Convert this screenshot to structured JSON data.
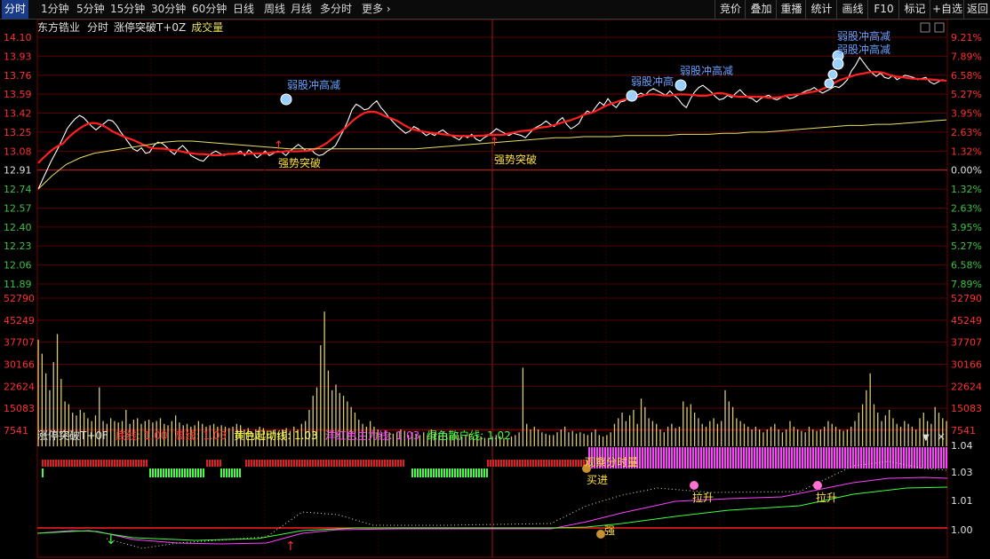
{
  "toolbar": {
    "periods": [
      "分时",
      "1分钟",
      "5分钟",
      "15分钟",
      "30分钟",
      "60分钟",
      "日线",
      "周线",
      "月线",
      "多分时",
      "更多"
    ],
    "right_buttons": [
      "竞价",
      "叠加",
      "重播",
      "统计",
      "画线",
      "F10",
      "标记",
      "+自选",
      "返回"
    ]
  },
  "header": {
    "stock": "东方锆业",
    "mode": "分时",
    "indicator": "涨停突破T+0Z",
    "volume_label": "成交量"
  },
  "price_axis": {
    "left": [
      "14.10",
      "13.93",
      "13.76",
      "13.59",
      "13.42",
      "13.25",
      "13.08",
      "12.91",
      "12.74",
      "12.57",
      "12.40",
      "12.23",
      "12.06",
      "11.89"
    ],
    "right": [
      "9.21%",
      "7.89%",
      "6.58%",
      "5.27%",
      "3.95%",
      "2.63%",
      "1.32%",
      "0.00%",
      "1.32%",
      "2.63%",
      "3.95%",
      "5.27%",
      "6.58%",
      "7.89%"
    ]
  },
  "volume_axis": [
    "52790",
    "45249",
    "37707",
    "30166",
    "22624",
    "15083",
    "7541"
  ],
  "indicator_panel": {
    "name": "涨停突破T+0F",
    "lines": [
      {
        "label": "底线:",
        "value": "1.00",
        "color": "#ff3030"
      },
      {
        "label": "高线:",
        "value": "1.03",
        "color": "#ff3030"
      },
      {
        "label": "黄色起动线:",
        "value": "1.03",
        "color": "#ffff40"
      },
      {
        "label": "洋红色主力线:",
        "value": "1.03",
        "color": "#ff40ff"
      },
      {
        "label": "绿色散户线:",
        "value": "1.02",
        "color": "#40ff40"
      }
    ],
    "axis": [
      "1.04",
      "1.03",
      "1.01",
      "1.00"
    ]
  },
  "annotations": {
    "weak": [
      "弱股冲高减",
      "弱股冲高",
      "弱股冲高减",
      "弱股冲高减",
      "弱股冲高减"
    ],
    "strong": [
      "强势突破",
      "强势突破"
    ],
    "observe": "观察分时量",
    "buy": "买进",
    "strong_lower": "强",
    "rise": [
      "拉升",
      "拉升"
    ]
  },
  "colors": {
    "up": "#ff3030",
    "price": "#ffffff",
    "avg": "#e8e060",
    "volume": "#d8c878",
    "grid": "#7a0000",
    "magenta": "#ff40ff",
    "green": "#40ff40"
  },
  "chart_data": {
    "type": "line",
    "prev_close": 12.91,
    "ylim": [
      11.89,
      14.1
    ],
    "vol_max": 52790,
    "price": [
      12.74,
      12.82,
      12.9,
      12.98,
      13.05,
      13.12,
      13.2,
      13.28,
      13.33,
      13.37,
      13.4,
      13.38,
      13.34,
      13.3,
      13.27,
      13.3,
      13.33,
      13.36,
      13.35,
      13.31,
      13.25,
      13.2,
      13.15,
      13.1,
      13.08,
      13.11,
      13.06,
      13.07,
      13.13,
      13.16,
      13.15,
      13.12,
      13.08,
      13.05,
      13.1,
      13.13,
      13.09,
      13.04,
      13.02,
      13.0,
      12.99,
      13.03,
      13.06,
      13.08,
      13.06,
      13.04,
      13.06,
      13.05,
      13.06,
      13.08,
      13.04,
      13.09,
      13.06,
      13.02,
      13.05,
      13.08,
      13.04,
      13.06,
      13.08,
      13.07,
      13.04,
      13.08,
      13.11,
      13.14,
      13.11,
      13.08,
      13.1,
      13.06,
      13.04,
      13.05,
      13.08,
      13.1,
      13.13,
      13.2,
      13.27,
      13.35,
      13.45,
      13.5,
      13.48,
      13.45,
      13.46,
      13.5,
      13.53,
      13.47,
      13.43,
      13.38,
      13.34,
      13.3,
      13.27,
      13.24,
      13.26,
      13.3,
      13.28,
      13.25,
      13.22,
      13.24,
      13.22,
      13.25,
      13.27,
      13.24,
      13.22,
      13.2,
      13.18,
      13.22,
      13.2,
      13.23,
      13.19,
      13.17,
      13.2,
      13.22,
      13.25,
      13.28,
      13.26,
      13.24,
      13.22,
      13.24,
      13.23,
      13.22,
      13.2,
      13.24,
      13.28,
      13.3,
      13.32,
      13.35,
      13.32,
      13.3,
      13.35,
      13.38,
      13.32,
      13.28,
      13.3,
      13.33,
      13.4,
      13.44,
      13.42,
      13.47,
      13.52,
      13.49,
      13.55,
      13.5,
      13.47,
      13.52,
      13.53,
      13.56,
      13.54,
      13.58,
      13.6,
      13.58,
      13.62,
      13.64,
      13.62,
      13.6,
      13.58,
      13.62,
      13.58,
      13.55,
      13.5,
      13.47,
      13.55,
      13.61,
      13.65,
      13.67,
      13.64,
      13.61,
      13.57,
      13.54,
      13.55,
      13.58,
      13.56,
      13.6,
      13.63,
      13.59,
      13.56,
      13.55,
      13.52,
      13.55,
      13.57,
      13.58,
      13.55,
      13.54,
      13.56,
      13.58,
      13.55,
      13.56,
      13.58,
      13.6,
      13.62,
      13.63,
      13.65,
      13.62,
      13.6,
      13.62,
      13.64,
      13.66,
      13.65,
      13.68,
      13.72,
      13.8,
      13.85,
      13.92,
      13.87,
      13.82,
      13.78,
      13.75,
      13.78,
      13.74,
      13.73,
      13.76,
      13.72,
      13.74,
      13.76,
      13.75,
      13.74,
      13.72,
      13.73,
      13.74,
      13.7,
      13.68,
      13.7,
      13.72,
      13.71
    ],
    "avg": [
      12.74,
      12.86,
      12.96,
      13.02,
      13.06,
      13.08,
      13.1,
      13.12,
      13.14,
      13.16,
      13.17,
      13.17,
      13.16,
      13.15,
      13.14,
      13.13,
      13.12,
      13.11,
      13.1,
      13.1,
      13.1,
      13.1,
      13.1,
      13.1,
      13.1,
      13.1,
      13.1,
      13.1,
      13.11,
      13.12,
      13.13,
      13.14,
      13.15,
      13.16,
      13.17,
      13.18,
      13.19,
      13.2,
      13.2,
      13.21,
      13.21,
      13.21,
      13.22,
      13.22,
      13.22,
      13.22,
      13.23,
      13.23,
      13.23,
      13.24,
      13.24,
      13.25,
      13.25,
      13.26,
      13.27,
      13.28,
      13.29,
      13.3,
      13.31,
      13.31,
      13.32,
      13.32,
      13.33,
      13.34,
      13.35,
      13.36
    ],
    "volume": [
      38000,
      33000,
      26000,
      20000,
      30000,
      40000,
      24000,
      16000,
      15000,
      12000,
      11000,
      13000,
      12000,
      10000,
      9000,
      11000,
      21000,
      9000,
      8000,
      10000,
      9000,
      8500,
      9000,
      13000,
      8000,
      9500,
      10000,
      8000,
      9000,
      9500,
      8500,
      9000,
      10000,
      8000,
      7500,
      9000,
      11000,
      8500,
      7500,
      8000,
      7000,
      7500,
      9000,
      8000,
      7000,
      7500,
      8000,
      7000,
      7500,
      7000,
      6500,
      7000,
      8000,
      7500,
      6000,
      6500,
      5000,
      6000,
      7000,
      6500,
      5500,
      5500,
      6000,
      5000,
      6000,
      6500,
      5500,
      7000,
      6000,
      8000,
      9000,
      13000,
      18000,
      21000,
      36000,
      48000,
      27000,
      20000,
      22000,
      19000,
      18000,
      16000,
      14000,
      12000,
      9500,
      8000,
      7000,
      9000,
      7000,
      6000,
      5000,
      5500,
      5000,
      4500,
      5000,
      6000,
      5500,
      4000,
      5000,
      4500,
      4000,
      5000,
      4000,
      6000,
      5000,
      4000,
      5000,
      4500,
      4000,
      4500,
      4000,
      3500,
      4000,
      4500,
      3500,
      4000,
      3500,
      3000,
      3000,
      3500,
      4000,
      3500,
      3000,
      2500,
      3500,
      4000,
      5000,
      28000,
      8000,
      6000,
      7000,
      6000,
      5000,
      4500,
      4000,
      4000,
      5000,
      6000,
      7000,
      5000,
      5500,
      4500,
      5000,
      4500,
      4000,
      5000,
      6000,
      4000,
      3500,
      4000,
      5000,
      8000,
      10000,
      12000,
      9000,
      11000,
      13000,
      8000,
      17000,
      14000,
      10000,
      9000,
      8000,
      6000,
      5000,
      7000,
      8000,
      6500,
      7000,
      16000,
      14000,
      15000,
      12000,
      10000,
      8000,
      7000,
      9000,
      10000,
      8000,
      9000,
      20000,
      16000,
      14000,
      10000,
      9000,
      8000,
      7000,
      6000,
      7000,
      6000,
      5000,
      6000,
      7000,
      8000,
      6000,
      5000,
      6000,
      9000,
      7000,
      6000,
      5500,
      5000,
      7000,
      6000,
      5500,
      6000,
      7000,
      9000,
      8000,
      7000,
      6000,
      5500,
      6000,
      7000,
      9000,
      12000,
      15000,
      20000,
      26000,
      15000,
      12000,
      9000,
      11000,
      13000,
      10000,
      8000,
      7000,
      9000,
      8000,
      7000,
      6000,
      10000,
      12000,
      9000,
      8000,
      14000,
      12000,
      10000,
      9000
    ]
  }
}
